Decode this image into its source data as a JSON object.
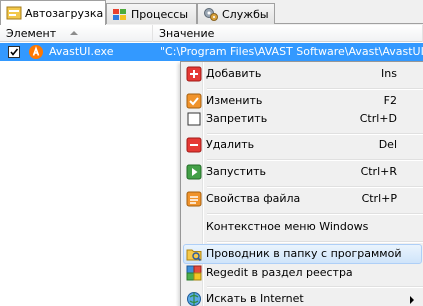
{
  "tabs": [
    {
      "label": "Автозагрузка",
      "icon": "startup-icon"
    },
    {
      "label": "Процессы",
      "icon": "processes-icon"
    },
    {
      "label": "Службы",
      "icon": "services-icon"
    }
  ],
  "columns": {
    "element": "Элемент",
    "value": "Значение"
  },
  "row": {
    "checked": true,
    "icon": "avast-icon",
    "name": "AvastUI.exe",
    "value": "\"C:\\Program Files\\AVAST Software\\Avast\\AvastUI"
  },
  "menu": {
    "items": [
      {
        "label": "Добавить",
        "shortcut": "Ins",
        "icon": "add-icon"
      },
      {
        "label": "Изменить",
        "shortcut": "F2",
        "icon": "edit-icon"
      },
      {
        "label": "Запретить",
        "shortcut": "Ctrl+D",
        "icon": "disable-checkbox-icon"
      },
      {
        "label": "Удалить",
        "shortcut": "Del",
        "icon": "delete-icon"
      },
      {
        "label": "Запустить",
        "shortcut": "Ctrl+R",
        "icon": "run-icon"
      },
      {
        "label": "Свойства файла",
        "shortcut": "Ctrl+P",
        "icon": "properties-icon"
      },
      {
        "label": "Контекстное меню Windows",
        "shortcut": "",
        "icon": ""
      },
      {
        "label": "Проводник в папку с программой",
        "shortcut": "",
        "icon": "explorer-folder-icon",
        "highlighted": true
      },
      {
        "label": "Regedit в раздел реестра",
        "shortcut": "",
        "icon": "regedit-icon"
      },
      {
        "label": "Искать в Internet",
        "shortcut": "",
        "icon": "internet-search-icon",
        "submenu": true
      }
    ]
  },
  "colors": {
    "selection": "#3399ff",
    "menu_background": "#f0f0f0",
    "menu_highlight": "#cfe4fa"
  }
}
